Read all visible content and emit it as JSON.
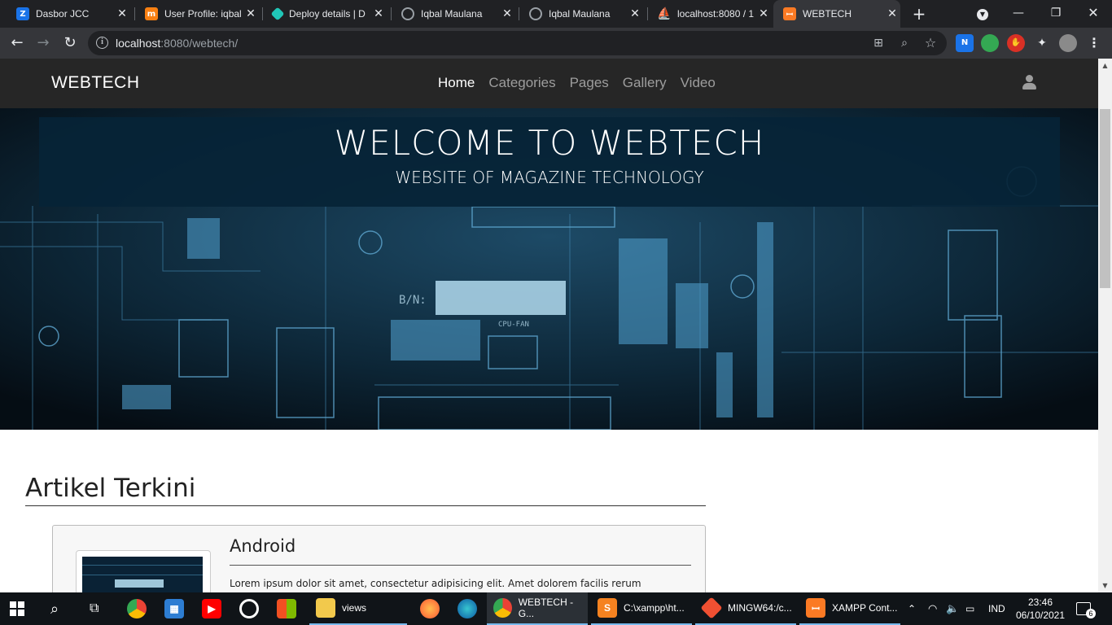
{
  "browser": {
    "tabs": [
      {
        "title": "Dasbor JCC",
        "icon": "jcc-icon",
        "color": "#1a73e8"
      },
      {
        "title": "User Profile: iqbal",
        "icon": "moodle-icon",
        "color": "#f98012"
      },
      {
        "title": "Deploy details | D",
        "icon": "netlify-icon",
        "color": "#20c6b7"
      },
      {
        "title": "Iqbal Maulana",
        "icon": "globe-icon",
        "color": "#9aa0a6"
      },
      {
        "title": "Iqbal Maulana",
        "icon": "globe-icon",
        "color": "#9aa0a6"
      },
      {
        "title": "localhost:8080 / 1",
        "icon": "phpmyadmin-icon",
        "color": "#f89c0e"
      },
      {
        "title": "WEBTECH",
        "icon": "xampp-icon",
        "color": "#fb7a24",
        "active": true
      }
    ],
    "url_host": "localhost",
    "url_rest": ":8080/webtech/"
  },
  "site": {
    "brand": "WEBTECH",
    "nav": [
      "Home",
      "Categories",
      "Pages",
      "Gallery",
      "Video"
    ],
    "hero_title": "WELCOME TO WEBTECH",
    "hero_subtitle": "WEBSITE OF MAGAZINE TECHNOLOGY",
    "section_title": "Artikel Terkini",
    "article": {
      "title": "Android",
      "text": "Lorem ipsum dolor sit amet, consectetur adipisicing elit. Amet dolorem facilis rerum"
    }
  },
  "taskbar": {
    "apps": [
      {
        "label": "views",
        "icon": "folder-icon",
        "color": "#f2c94c"
      },
      {
        "label": "WEBTECH - G...",
        "icon": "chrome-icon",
        "color": "#4285f4"
      },
      {
        "label": "C:\\xampp\\ht...",
        "icon": "sublime-icon",
        "color": "#f58220"
      },
      {
        "label": "MINGW64:/c...",
        "icon": "git-icon",
        "color": "#f05032"
      },
      {
        "label": "XAMPP Cont...",
        "icon": "xampp-icon",
        "color": "#fb7a24"
      }
    ],
    "lang": "IND",
    "time": "23:46",
    "date": "06/10/2021",
    "notifications": "6"
  }
}
